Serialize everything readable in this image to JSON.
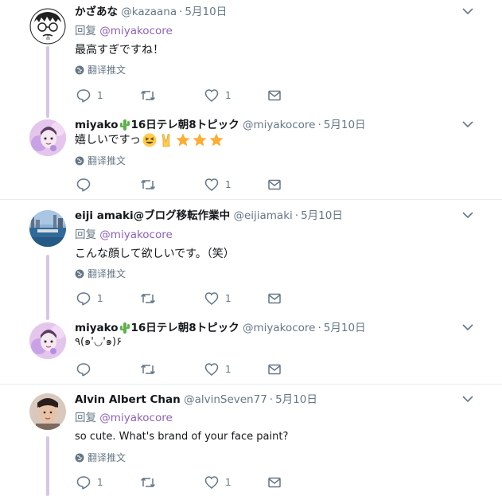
{
  "tweets": [
    {
      "name": "かざあな",
      "handle": "@kazaana",
      "time": "5月10日",
      "reply_prefix": "回复",
      "reply_to": "@miyakocore",
      "text": "最高すぎですね！",
      "translate": "翻译推文",
      "replies": "1",
      "retweets": "",
      "likes": "1"
    },
    {
      "name": "miyako",
      "name_suffix": "16日テレ朝8トピック",
      "handle": "@miyakocore",
      "time": "5月10日",
      "text": "嬉しいですっ",
      "emojis": [
        "grinning-squinting-face",
        "sign-of-horns",
        "star",
        "star",
        "star"
      ],
      "translate": "翻译推文",
      "replies": "",
      "retweets": "",
      "likes": "1"
    },
    {
      "name": "eiji amaki@ブログ移転作業中",
      "handle": "@eijiamaki",
      "time": "5月10日",
      "reply_prefix": "回复",
      "reply_to": "@miyakocore",
      "text": "こんな顔して欲しいです。（笑）",
      "translate": "翻译推文",
      "replies": "1",
      "retweets": "",
      "likes": "1"
    },
    {
      "name": "miyako",
      "name_suffix": "16日テレ朝8トピック",
      "handle": "@miyakocore",
      "time": "5月10日",
      "text": "٩(๑'◡'๑)۶",
      "replies": "",
      "retweets": "",
      "likes": "1"
    },
    {
      "name": "Alvin Albert Chan",
      "handle": "@alvinSeven77",
      "time": "5月10日",
      "reply_prefix": "回复",
      "reply_to": "@miyakocore",
      "text": "so cute. What's brand of your face paint?",
      "translate": "翻译推文",
      "replies": "1",
      "retweets": "",
      "likes": "1"
    }
  ],
  "colors": {
    "link": "#8e60b8",
    "muted": "#657786",
    "thread": "#d7c6e6",
    "cactus": "#5fb04a",
    "star": "#ffac33"
  }
}
